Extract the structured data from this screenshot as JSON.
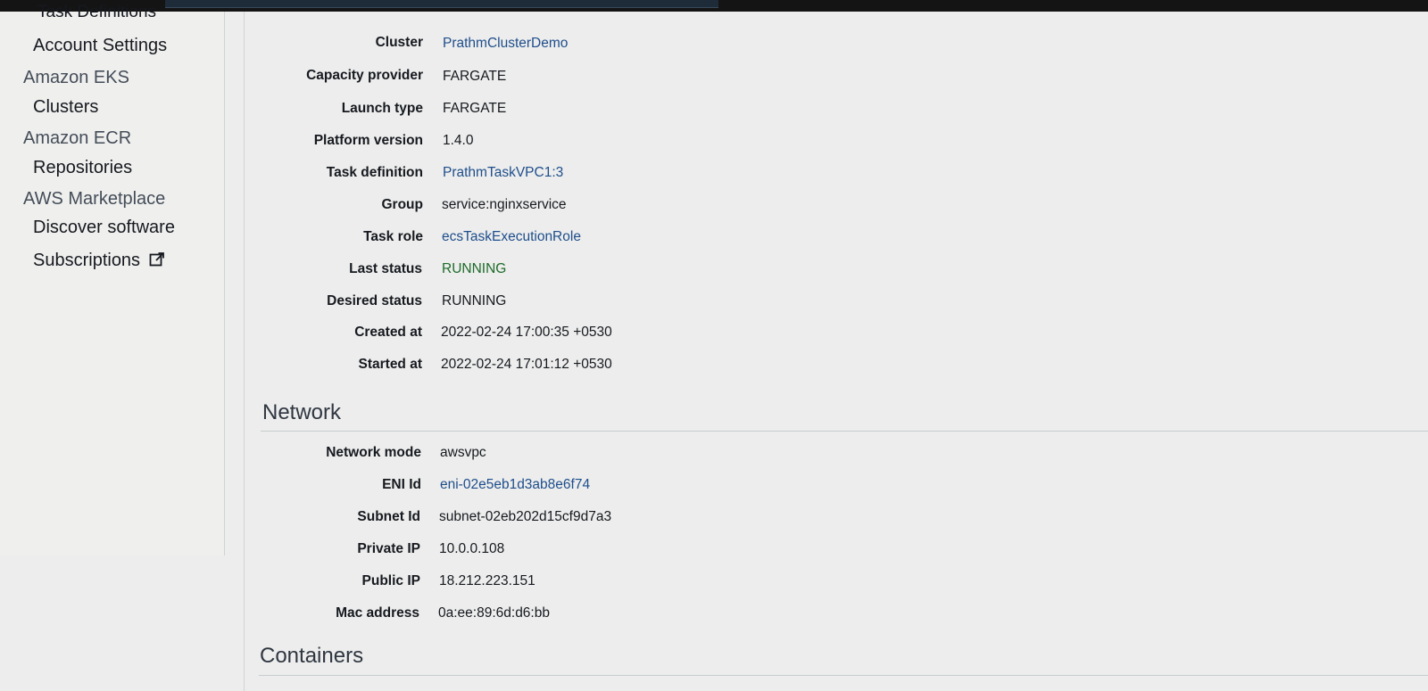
{
  "sidebar": {
    "cut_item": "Task Definitions",
    "items": [
      {
        "label": "Account Settings",
        "kind": "child"
      },
      {
        "label": "Amazon EKS",
        "kind": "section"
      },
      {
        "label": "Clusters",
        "kind": "child"
      },
      {
        "label": "Amazon ECR",
        "kind": "section"
      },
      {
        "label": "Repositories",
        "kind": "child"
      },
      {
        "label": "AWS Marketplace",
        "kind": "section"
      },
      {
        "label": "Discover software",
        "kind": "child"
      },
      {
        "label": "Subscriptions",
        "kind": "child",
        "icon": "external-link-icon"
      }
    ]
  },
  "details": {
    "cluster": {
      "label": "Cluster",
      "value": "PrathmClusterDemo"
    },
    "capacity_provider": {
      "label": "Capacity provider",
      "value": "FARGATE"
    },
    "launch_type": {
      "label": "Launch type",
      "value": "FARGATE"
    },
    "platform_version": {
      "label": "Platform version",
      "value": "1.4.0"
    },
    "task_definition": {
      "label": "Task definition",
      "value": "PrathmTaskVPC1:3"
    },
    "group": {
      "label": "Group",
      "value": "service:nginxservice"
    },
    "task_role": {
      "label": "Task role",
      "value": "ecsTaskExecutionRole"
    },
    "last_status": {
      "label": "Last status",
      "value": "RUNNING"
    },
    "desired_status": {
      "label": "Desired status",
      "value": "RUNNING"
    },
    "created_at": {
      "label": "Created at",
      "value": "2022-02-24 17:00:35 +0530"
    },
    "started_at": {
      "label": "Started at",
      "value": "2022-02-24 17:01:12 +0530"
    }
  },
  "network": {
    "title": "Network",
    "network_mode": {
      "label": "Network mode",
      "value": "awsvpc"
    },
    "eni_id": {
      "label": "ENI Id",
      "value": "eni-02e5eb1d3ab8e6f74"
    },
    "subnet_id": {
      "label": "Subnet Id",
      "value": "subnet-02eb202d15cf9d7a3"
    },
    "private_ip": {
      "label": "Private IP",
      "value": "10.0.0.108"
    },
    "public_ip": {
      "label": "Public IP",
      "value": "18.212.223.151"
    },
    "mac_address": {
      "label": "Mac address",
      "value": "0a:ee:89:6d:d6:bb"
    }
  },
  "containers": {
    "title": "Containers"
  },
  "colors": {
    "link": "#1f4e8c",
    "status_running": "#1d6b2a",
    "page_bg": "#ecedec",
    "top_bar": "#141414"
  }
}
